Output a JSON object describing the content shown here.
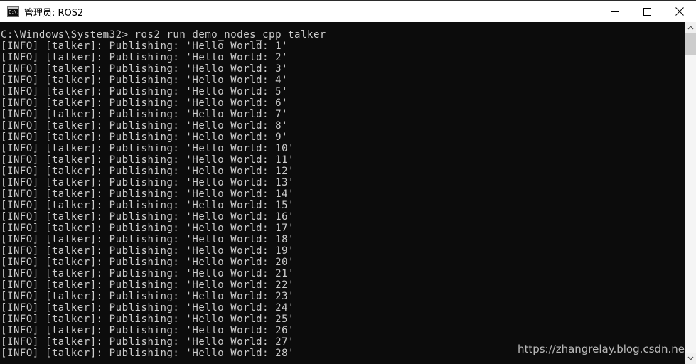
{
  "window": {
    "title": "管理员: ROS2",
    "icon": "console-icon",
    "icon_text": "C:\\.",
    "colors": {
      "titlebar_bg": "#ffffff",
      "console_bg": "#0c0c0c",
      "console_fg": "#cccccc",
      "scrollbar_track": "#f0f0f0",
      "scrollbar_thumb": "#cdcdcd"
    },
    "controls": {
      "minimize": "minimize-icon",
      "maximize": "maximize-icon",
      "close": "close-icon"
    }
  },
  "console": {
    "prompt_line": "C:\\Windows\\System32> ros2 run demo_nodes_cpp talker",
    "prompt_path": "C:\\Windows\\System32>",
    "command": "ros2 run demo_nodes_cpp talker",
    "log_level": "[INFO]",
    "node_name": "[talker]",
    "message_prefix": "Publishing: 'Hello World: ",
    "message_suffix": "'",
    "lines": [
      "C:\\Windows\\System32> ros2 run demo_nodes_cpp talker",
      "[INFO] [talker]: Publishing: 'Hello World: 1'",
      "[INFO] [talker]: Publishing: 'Hello World: 2'",
      "[INFO] [talker]: Publishing: 'Hello World: 3'",
      "[INFO] [talker]: Publishing: 'Hello World: 4'",
      "[INFO] [talker]: Publishing: 'Hello World: 5'",
      "[INFO] [talker]: Publishing: 'Hello World: 6'",
      "[INFO] [talker]: Publishing: 'Hello World: 7'",
      "[INFO] [talker]: Publishing: 'Hello World: 8'",
      "[INFO] [talker]: Publishing: 'Hello World: 9'",
      "[INFO] [talker]: Publishing: 'Hello World: 10'",
      "[INFO] [talker]: Publishing: 'Hello World: 11'",
      "[INFO] [talker]: Publishing: 'Hello World: 12'",
      "[INFO] [talker]: Publishing: 'Hello World: 13'",
      "[INFO] [talker]: Publishing: 'Hello World: 14'",
      "[INFO] [talker]: Publishing: 'Hello World: 15'",
      "[INFO] [talker]: Publishing: 'Hello World: 16'",
      "[INFO] [talker]: Publishing: 'Hello World: 17'",
      "[INFO] [talker]: Publishing: 'Hello World: 18'",
      "[INFO] [talker]: Publishing: 'Hello World: 19'",
      "[INFO] [talker]: Publishing: 'Hello World: 20'",
      "[INFO] [talker]: Publishing: 'Hello World: 21'",
      "[INFO] [talker]: Publishing: 'Hello World: 22'",
      "[INFO] [talker]: Publishing: 'Hello World: 23'",
      "[INFO] [talker]: Publishing: 'Hello World: 24'",
      "[INFO] [talker]: Publishing: 'Hello World: 25'",
      "[INFO] [talker]: Publishing: 'Hello World: 26'",
      "[INFO] [talker]: Publishing: 'Hello World: 27'",
      "[INFO] [talker]: Publishing: 'Hello World: 28'"
    ],
    "first_counter": 1,
    "last_counter": 28,
    "line_count": 29
  },
  "watermark": {
    "text": "https://zhangrelay.blog.csdn.ne"
  },
  "scrollbar": {
    "up_arrow": "chevron-up-icon",
    "down_arrow": "chevron-down-icon",
    "thumb_position": "near-top"
  }
}
